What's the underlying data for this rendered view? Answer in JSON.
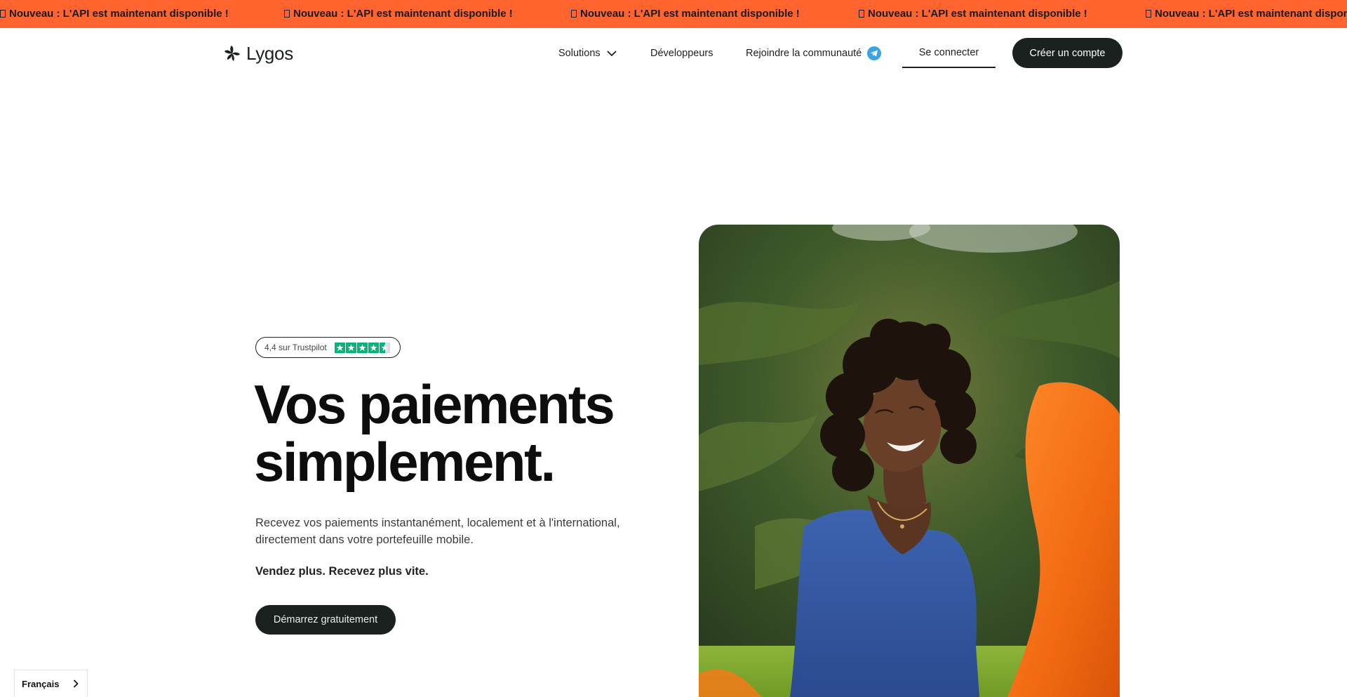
{
  "banner": {
    "message": "Nouveau : L'API est maintenant disponible !",
    "icon": "megaphone-icon",
    "background": "#ff642f"
  },
  "header": {
    "logo_text": "Lygos",
    "nav": {
      "solutions": "Solutions",
      "developers": "Développeurs",
      "community": "Rejoindre la communauté",
      "login": "Se connecter"
    },
    "signup": "Créer un compte"
  },
  "hero": {
    "trustpilot": {
      "text": "4,4 sur Trustpilot",
      "rating": 4.4,
      "max": 5,
      "color": "#00b67a"
    },
    "title_line1": "Vos paiements",
    "title_line2": "simplement.",
    "description": "Recevez vos paiements instantanément, localement et à l'international, directement dans votre portefeuille mobile.",
    "tagline": "Vendez plus. Recevez plus vite.",
    "cta": "Démarrez gratuitement"
  },
  "language": {
    "selected": "Français"
  },
  "colors": {
    "dark": "#1b211f",
    "accent": "#ff642f",
    "telegram": "#3aa3e3"
  }
}
